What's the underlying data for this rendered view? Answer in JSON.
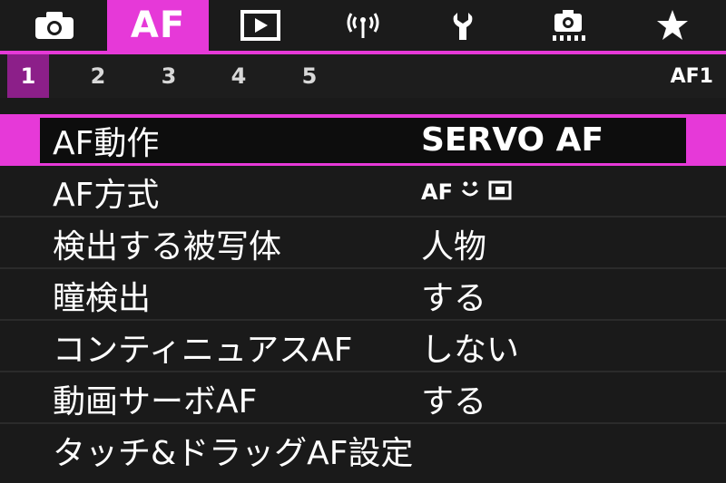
{
  "tabs": [
    {
      "name": "camera-icon",
      "label": ""
    },
    {
      "name": "af-tab",
      "label": "AF"
    },
    {
      "name": "playback-icon",
      "label": ""
    },
    {
      "name": "wireless-icon",
      "label": "((ı))"
    },
    {
      "name": "wrench-icon",
      "label": ""
    },
    {
      "name": "custom-shoot-icon",
      "label": ""
    },
    {
      "name": "star-icon",
      "label": "★"
    }
  ],
  "subtabs": [
    "1",
    "2",
    "3",
    "4",
    "5"
  ],
  "subbar_id": "AF1",
  "menu": [
    {
      "label": "AF動作",
      "value": "SERVO AF"
    },
    {
      "label": "AF方式",
      "value": "AF"
    },
    {
      "label": "検出する被写体",
      "value": "人物"
    },
    {
      "label": "瞳検出",
      "value": "する"
    },
    {
      "label": "コンティニュアスAF",
      "value": "しない"
    },
    {
      "label": "動画サーボAF",
      "value": "する"
    },
    {
      "label": "タッチ&ドラッグAF設定",
      "value": ""
    }
  ],
  "colors": {
    "accent": "#e639d8",
    "subtab_active": "#8c1f89",
    "background": "#1a1a1a"
  }
}
